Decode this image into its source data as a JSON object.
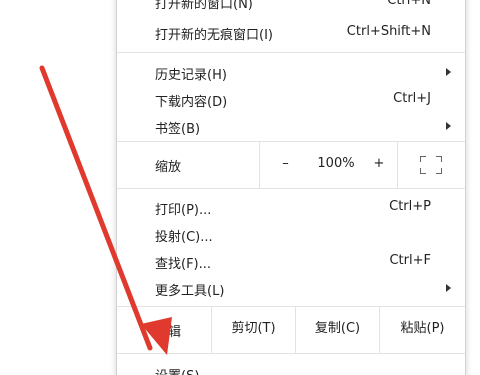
{
  "menu": {
    "new_window": {
      "label": "打开新的窗口(N)",
      "shortcut": "Ctrl+N"
    },
    "new_incognito": {
      "label": "打开新的无痕窗口(I)",
      "shortcut": "Ctrl+Shift+N"
    },
    "history": {
      "label": "历史记录(H)"
    },
    "downloads": {
      "label": "下载内容(D)",
      "shortcut": "Ctrl+J"
    },
    "bookmarks": {
      "label": "书签(B)"
    },
    "zoom": {
      "label": "缩放",
      "minus": "–",
      "value": "100%",
      "plus": "+"
    },
    "print": {
      "label": "打印(P)...",
      "shortcut": "Ctrl+P"
    },
    "cast": {
      "label": "投射(C)..."
    },
    "find": {
      "label": "查找(F)...",
      "shortcut": "Ctrl+F"
    },
    "more_tools": {
      "label": "更多工具(L)"
    },
    "edit": {
      "label": "编辑",
      "cut": "剪切(T)",
      "copy": "复制(C)",
      "paste": "粘贴(P)"
    },
    "settings": {
      "label": "设置(S)"
    }
  },
  "annotation": {
    "arrow_color": "#e03a2f"
  }
}
